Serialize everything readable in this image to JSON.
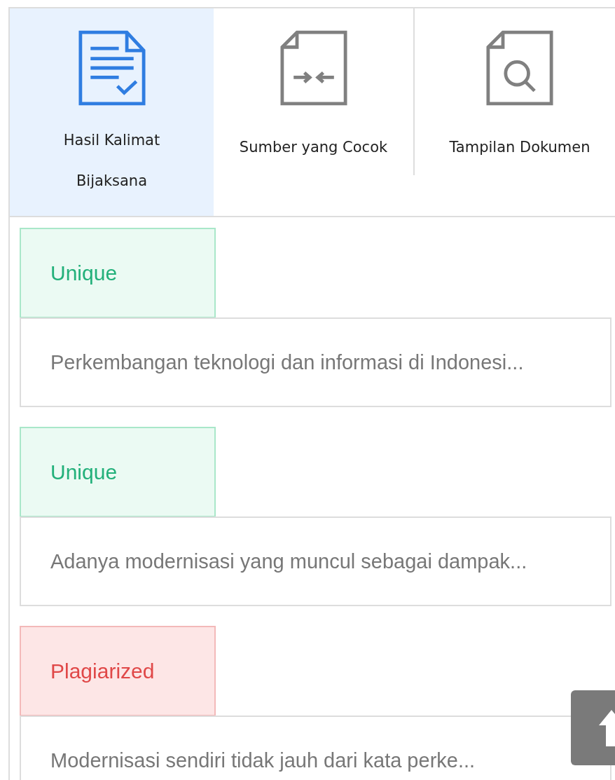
{
  "tabs": [
    {
      "label": "Hasil Kalimat Bijaksana",
      "selected": true
    },
    {
      "label": "Sumber yang Cocok",
      "selected": false
    },
    {
      "label": "Tampilan Dokumen",
      "selected": false
    }
  ],
  "results": [
    {
      "kind": "unique",
      "status": "Unique",
      "sentence": "Perkembangan teknologi dan informasi di Indonesi..."
    },
    {
      "kind": "unique",
      "status": "Unique",
      "sentence": "Adanya modernisasi yang muncul sebagai dampak..."
    },
    {
      "kind": "plagiarized",
      "status": "Plagiarized",
      "sentence": "Modernisasi sendiri tidak jauh dari kata perke..."
    }
  ]
}
